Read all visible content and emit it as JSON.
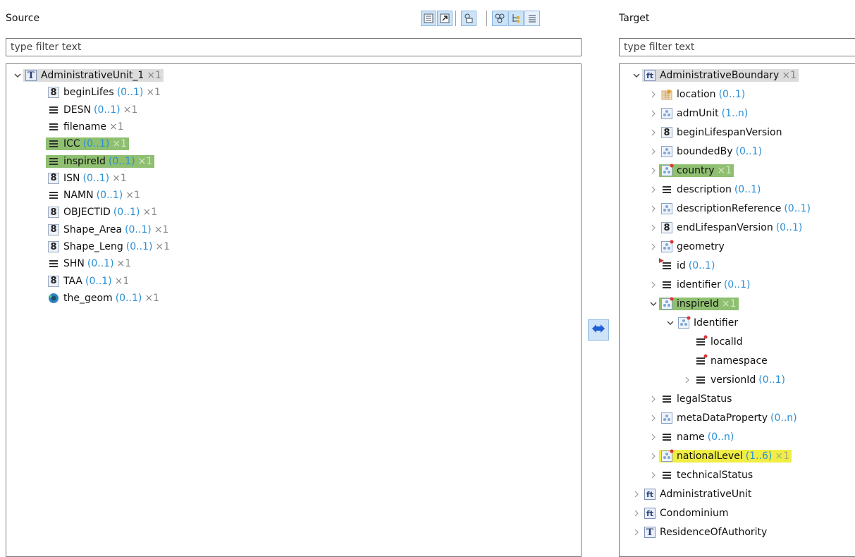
{
  "source": {
    "title": "Source",
    "filter_placeholder": "type filter text",
    "root": {
      "label": "AdministrativeUnit_1",
      "mult": "×1",
      "icon": "type-T-icon"
    },
    "items": [
      {
        "icon": "number-icon",
        "name": "beginLifes",
        "card": "(0..1)",
        "mult": "×1",
        "highlight": ""
      },
      {
        "icon": "string-icon",
        "name": "DESN",
        "card": "(0..1)",
        "mult": "×1",
        "highlight": ""
      },
      {
        "icon": "string-icon",
        "name": "filename",
        "card": "",
        "mult": "×1",
        "highlight": ""
      },
      {
        "icon": "string-icon",
        "name": "ICC",
        "card": "(0..1)",
        "mult": "×1",
        "highlight": "green"
      },
      {
        "icon": "string-icon",
        "name": "inspireId",
        "card": "(0..1)",
        "mult": "×1",
        "highlight": "green"
      },
      {
        "icon": "number-icon",
        "name": "ISN",
        "card": "(0..1)",
        "mult": "×1",
        "highlight": ""
      },
      {
        "icon": "string-icon",
        "name": "NAMN",
        "card": "(0..1)",
        "mult": "×1",
        "highlight": ""
      },
      {
        "icon": "number-icon",
        "name": "OBJECTID",
        "card": "(0..1)",
        "mult": "×1",
        "highlight": ""
      },
      {
        "icon": "number-icon",
        "name": "Shape_Area",
        "card": "(0..1)",
        "mult": "×1",
        "highlight": ""
      },
      {
        "icon": "number-icon",
        "name": "Shape_Leng",
        "card": "(0..1)",
        "mult": "×1",
        "highlight": ""
      },
      {
        "icon": "string-icon",
        "name": "SHN",
        "card": "(0..1)",
        "mult": "×1",
        "highlight": ""
      },
      {
        "icon": "number-icon",
        "name": "TAA",
        "card": "(0..1)",
        "mult": "×1",
        "highlight": ""
      },
      {
        "icon": "geometry-icon",
        "name": "the_geom",
        "card": "(0..1)",
        "mult": "×1",
        "highlight": ""
      }
    ]
  },
  "target": {
    "title": "Target",
    "filter_placeholder": "type filter text",
    "root": {
      "label": "AdministrativeBoundary",
      "mult": "×1",
      "icon": "feature-type-icon"
    },
    "items": [
      {
        "icon": "location-icon",
        "name": "location",
        "card": "(0..1)",
        "mult": "",
        "highlight": "",
        "expander": "collapsed",
        "indent": 1
      },
      {
        "icon": "complex-icon",
        "name": "admUnit",
        "card": "(1..n)",
        "mult": "",
        "highlight": "",
        "expander": "collapsed",
        "indent": 1
      },
      {
        "icon": "number-icon",
        "name": "beginLifespanVersion",
        "card": "",
        "mult": "",
        "highlight": "",
        "expander": "collapsed",
        "indent": 1
      },
      {
        "icon": "complex-icon",
        "name": "boundedBy",
        "card": "(0..1)",
        "mult": "",
        "highlight": "",
        "expander": "collapsed",
        "indent": 1
      },
      {
        "icon": "complex-required-icon",
        "name": "country",
        "card": "",
        "mult": "×1",
        "highlight": "green",
        "expander": "collapsed",
        "indent": 1
      },
      {
        "icon": "string-icon",
        "name": "description",
        "card": "(0..1)",
        "mult": "",
        "highlight": "",
        "expander": "collapsed",
        "indent": 1
      },
      {
        "icon": "complex-icon",
        "name": "descriptionReference",
        "card": "(0..1)",
        "mult": "",
        "highlight": "",
        "expander": "collapsed",
        "indent": 1
      },
      {
        "icon": "number-icon",
        "name": "endLifespanVersion",
        "card": "(0..1)",
        "mult": "",
        "highlight": "",
        "expander": "collapsed",
        "indent": 1
      },
      {
        "icon": "complex-required-icon",
        "name": "geometry",
        "card": "",
        "mult": "",
        "highlight": "",
        "expander": "collapsed",
        "indent": 1
      },
      {
        "icon": "attribute-icon",
        "name": "id",
        "card": "(0..1)",
        "mult": "",
        "highlight": "",
        "expander": "none",
        "indent": 1
      },
      {
        "icon": "string-icon",
        "name": "identifier",
        "card": "(0..1)",
        "mult": "",
        "highlight": "",
        "expander": "collapsed",
        "indent": 1
      },
      {
        "icon": "complex-required-icon",
        "name": "inspireId",
        "card": "",
        "mult": "×1",
        "highlight": "green",
        "expander": "expanded",
        "indent": 1
      },
      {
        "icon": "complex-required-icon",
        "name": "Identifier",
        "card": "",
        "mult": "",
        "highlight": "",
        "expander": "expanded",
        "indent": 2
      },
      {
        "icon": "string-required-icon",
        "name": "localId",
        "card": "",
        "mult": "",
        "highlight": "",
        "expander": "none",
        "indent": 3
      },
      {
        "icon": "string-required-icon",
        "name": "namespace",
        "card": "",
        "mult": "",
        "highlight": "",
        "expander": "none",
        "indent": 3
      },
      {
        "icon": "string-icon",
        "name": "versionId",
        "card": "(0..1)",
        "mult": "",
        "highlight": "",
        "expander": "collapsed",
        "indent": 3
      },
      {
        "icon": "string-icon",
        "name": "legalStatus",
        "card": "",
        "mult": "",
        "highlight": "",
        "expander": "collapsed",
        "indent": 1
      },
      {
        "icon": "complex-icon",
        "name": "metaDataProperty",
        "card": "(0..n)",
        "mult": "",
        "highlight": "",
        "expander": "collapsed",
        "indent": 1
      },
      {
        "icon": "string-icon",
        "name": "name",
        "card": "(0..n)",
        "mult": "",
        "highlight": "",
        "expander": "collapsed",
        "indent": 1
      },
      {
        "icon": "complex-required-icon",
        "name": "nationalLevel",
        "card": "(1..6)",
        "mult": "×1",
        "highlight": "yellow",
        "expander": "collapsed",
        "indent": 1
      },
      {
        "icon": "string-icon",
        "name": "technicalStatus",
        "card": "",
        "mult": "",
        "highlight": "",
        "expander": "collapsed",
        "indent": 1
      },
      {
        "icon": "feature-type-icon",
        "name": "AdministrativeUnit",
        "card": "",
        "mult": "",
        "highlight": "",
        "expander": "collapsed",
        "indent": 0
      },
      {
        "icon": "feature-type-icon",
        "name": "Condominium",
        "card": "",
        "mult": "",
        "highlight": "",
        "expander": "collapsed",
        "indent": 0
      },
      {
        "icon": "type-T-icon",
        "name": "ResidenceOfAuthority",
        "card": "",
        "mult": "",
        "highlight": "",
        "expander": "collapsed",
        "indent": 0
      }
    ]
  },
  "toolbar": {
    "buttons": [
      {
        "name": "show-list-button",
        "icon": "list-details-icon"
      },
      {
        "name": "link-editor-button",
        "icon": "arrow-link-icon"
      },
      {
        "name": "show-types-button",
        "icon": "type-filter-icon"
      },
      {
        "name": "show-relations-button",
        "icon": "relations-icon"
      },
      {
        "name": "tree-layout-button",
        "icon": "tree-icon"
      },
      {
        "name": "flat-list-button",
        "icon": "flat-list-icon"
      }
    ]
  },
  "mapping_button": {
    "icon": "bidirectional-arrow-icon"
  },
  "colors": {
    "highlight_green": "#8fbf70",
    "highlight_yellow": "#f0ee44",
    "cardinality": "#2a8fd6",
    "multiplicity": "#888888",
    "toolbar_active": "#cde3f7"
  }
}
